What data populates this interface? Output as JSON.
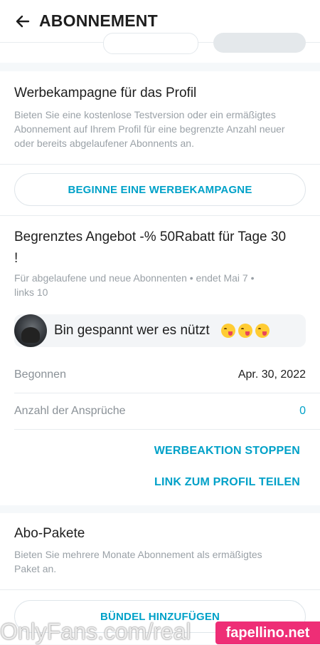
{
  "header": {
    "title": "ABONNEMENT",
    "back_icon": "arrow-left-icon"
  },
  "promo_campaign": {
    "title": "Werbekampagne für das Profil",
    "description_lines": [
      "Bieten Sie eine kostenlose Testversion oder ein ermäßigtes",
      "Abonnement auf Ihrem Profil für eine begrenzte Anzahl neuer",
      "oder bereits abgelaufener Abonnents an."
    ],
    "button_label": "BEGINNE EINE WERBEKAMPAGNE"
  },
  "offer": {
    "title_line1": "Begrenztes Angebot -% 50Rabatt für Tage 30",
    "title_line2": "!",
    "meta_line1": "Für abgelaufene und neue Abonnenten  •  endet Mai 7  •",
    "meta_line2": "links 10",
    "message": "Bin gespannt wer es nützt",
    "message_emojis": [
      "yum-face-emoji",
      "yum-face-emoji",
      "yum-face-emoji"
    ],
    "started_label": "Begonnen",
    "started_value": "Apr. 30, 2022",
    "claims_label": "Anzahl der Ansprüche",
    "claims_value": "0",
    "stop_label": "WERBEAKTION STOPPEN",
    "share_label": "LINK ZUM PROFIL TEILEN"
  },
  "bundles": {
    "title": "Abo-Pakete",
    "description_lines": [
      "Bieten Sie mehrere Monate Abonnement als ermäßigtes",
      "Paket an."
    ],
    "button_label": "BÜNDEL HINZUFÜGEN"
  },
  "watermark": {
    "left_text": "OnlyFans.com/real",
    "right_text": "fapellino.net"
  },
  "colors": {
    "accent": "#00a1c8",
    "muted": "#9aa1a7",
    "watermark_pink": "#ee2e76"
  }
}
